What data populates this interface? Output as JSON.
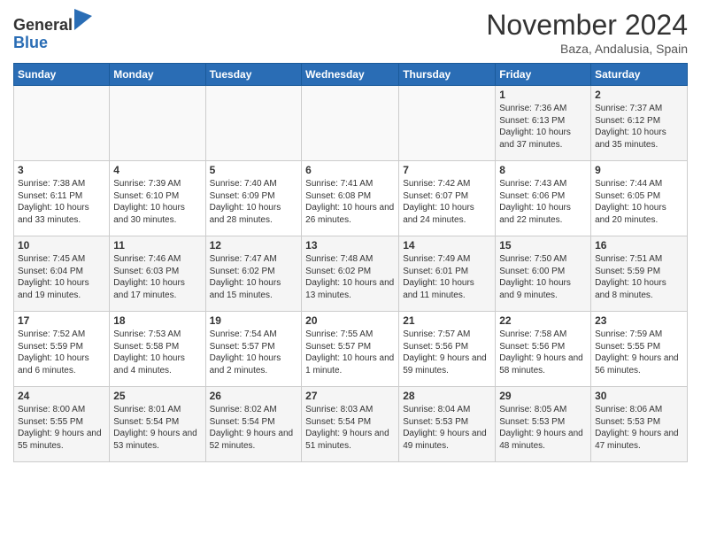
{
  "header": {
    "logo_line1": "General",
    "logo_line2": "Blue",
    "month": "November 2024",
    "location": "Baza, Andalusia, Spain"
  },
  "weekdays": [
    "Sunday",
    "Monday",
    "Tuesday",
    "Wednesday",
    "Thursday",
    "Friday",
    "Saturday"
  ],
  "weeks": [
    [
      {
        "day": "",
        "info": ""
      },
      {
        "day": "",
        "info": ""
      },
      {
        "day": "",
        "info": ""
      },
      {
        "day": "",
        "info": ""
      },
      {
        "day": "",
        "info": ""
      },
      {
        "day": "1",
        "info": "Sunrise: 7:36 AM\nSunset: 6:13 PM\nDaylight: 10 hours\nand 37 minutes."
      },
      {
        "day": "2",
        "info": "Sunrise: 7:37 AM\nSunset: 6:12 PM\nDaylight: 10 hours\nand 35 minutes."
      }
    ],
    [
      {
        "day": "3",
        "info": "Sunrise: 7:38 AM\nSunset: 6:11 PM\nDaylight: 10 hours\nand 33 minutes."
      },
      {
        "day": "4",
        "info": "Sunrise: 7:39 AM\nSunset: 6:10 PM\nDaylight: 10 hours\nand 30 minutes."
      },
      {
        "day": "5",
        "info": "Sunrise: 7:40 AM\nSunset: 6:09 PM\nDaylight: 10 hours\nand 28 minutes."
      },
      {
        "day": "6",
        "info": "Sunrise: 7:41 AM\nSunset: 6:08 PM\nDaylight: 10 hours\nand 26 minutes."
      },
      {
        "day": "7",
        "info": "Sunrise: 7:42 AM\nSunset: 6:07 PM\nDaylight: 10 hours\nand 24 minutes."
      },
      {
        "day": "8",
        "info": "Sunrise: 7:43 AM\nSunset: 6:06 PM\nDaylight: 10 hours\nand 22 minutes."
      },
      {
        "day": "9",
        "info": "Sunrise: 7:44 AM\nSunset: 6:05 PM\nDaylight: 10 hours\nand 20 minutes."
      }
    ],
    [
      {
        "day": "10",
        "info": "Sunrise: 7:45 AM\nSunset: 6:04 PM\nDaylight: 10 hours\nand 19 minutes."
      },
      {
        "day": "11",
        "info": "Sunrise: 7:46 AM\nSunset: 6:03 PM\nDaylight: 10 hours\nand 17 minutes."
      },
      {
        "day": "12",
        "info": "Sunrise: 7:47 AM\nSunset: 6:02 PM\nDaylight: 10 hours\nand 15 minutes."
      },
      {
        "day": "13",
        "info": "Sunrise: 7:48 AM\nSunset: 6:02 PM\nDaylight: 10 hours\nand 13 minutes."
      },
      {
        "day": "14",
        "info": "Sunrise: 7:49 AM\nSunset: 6:01 PM\nDaylight: 10 hours\nand 11 minutes."
      },
      {
        "day": "15",
        "info": "Sunrise: 7:50 AM\nSunset: 6:00 PM\nDaylight: 10 hours\nand 9 minutes."
      },
      {
        "day": "16",
        "info": "Sunrise: 7:51 AM\nSunset: 5:59 PM\nDaylight: 10 hours\nand 8 minutes."
      }
    ],
    [
      {
        "day": "17",
        "info": "Sunrise: 7:52 AM\nSunset: 5:59 PM\nDaylight: 10 hours\nand 6 minutes."
      },
      {
        "day": "18",
        "info": "Sunrise: 7:53 AM\nSunset: 5:58 PM\nDaylight: 10 hours\nand 4 minutes."
      },
      {
        "day": "19",
        "info": "Sunrise: 7:54 AM\nSunset: 5:57 PM\nDaylight: 10 hours\nand 2 minutes."
      },
      {
        "day": "20",
        "info": "Sunrise: 7:55 AM\nSunset: 5:57 PM\nDaylight: 10 hours\nand 1 minute."
      },
      {
        "day": "21",
        "info": "Sunrise: 7:57 AM\nSunset: 5:56 PM\nDaylight: 9 hours\nand 59 minutes."
      },
      {
        "day": "22",
        "info": "Sunrise: 7:58 AM\nSunset: 5:56 PM\nDaylight: 9 hours\nand 58 minutes."
      },
      {
        "day": "23",
        "info": "Sunrise: 7:59 AM\nSunset: 5:55 PM\nDaylight: 9 hours\nand 56 minutes."
      }
    ],
    [
      {
        "day": "24",
        "info": "Sunrise: 8:00 AM\nSunset: 5:55 PM\nDaylight: 9 hours\nand 55 minutes."
      },
      {
        "day": "25",
        "info": "Sunrise: 8:01 AM\nSunset: 5:54 PM\nDaylight: 9 hours\nand 53 minutes."
      },
      {
        "day": "26",
        "info": "Sunrise: 8:02 AM\nSunset: 5:54 PM\nDaylight: 9 hours\nand 52 minutes."
      },
      {
        "day": "27",
        "info": "Sunrise: 8:03 AM\nSunset: 5:54 PM\nDaylight: 9 hours\nand 51 minutes."
      },
      {
        "day": "28",
        "info": "Sunrise: 8:04 AM\nSunset: 5:53 PM\nDaylight: 9 hours\nand 49 minutes."
      },
      {
        "day": "29",
        "info": "Sunrise: 8:05 AM\nSunset: 5:53 PM\nDaylight: 9 hours\nand 48 minutes."
      },
      {
        "day": "30",
        "info": "Sunrise: 8:06 AM\nSunset: 5:53 PM\nDaylight: 9 hours\nand 47 minutes."
      }
    ]
  ]
}
